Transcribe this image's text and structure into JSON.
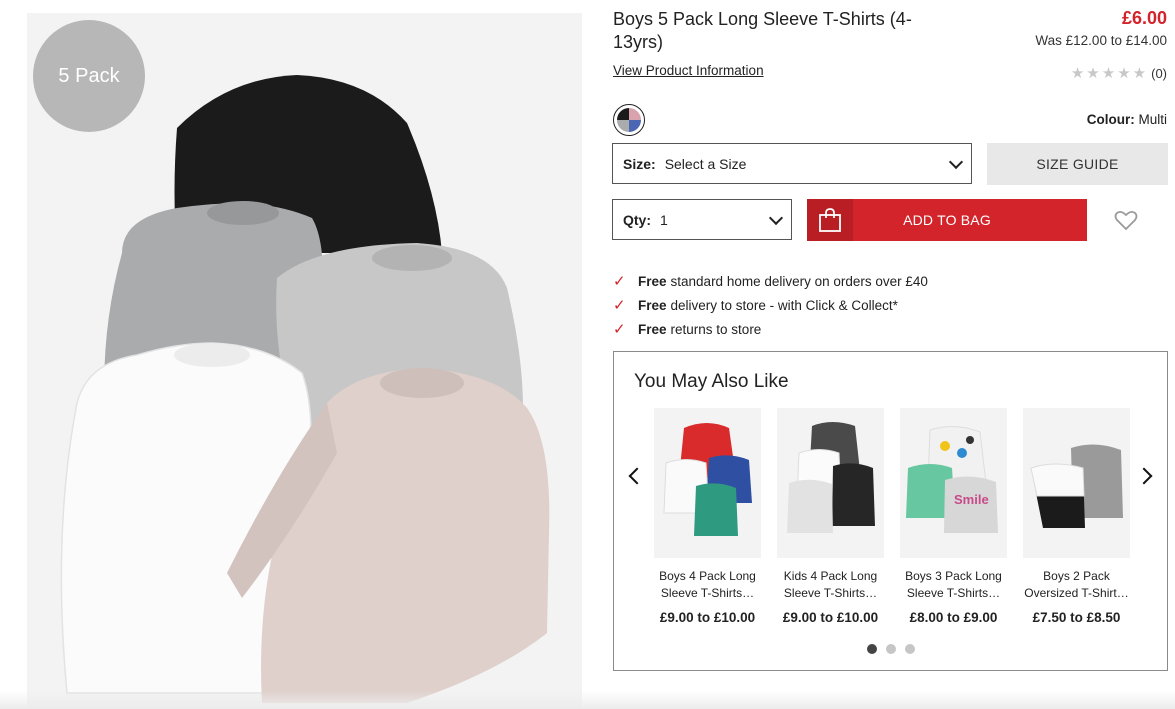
{
  "product": {
    "badge": "5 Pack",
    "title": "Boys 5 Pack Long Sleeve T-Shirts (4-13yrs)",
    "price": "£6.00",
    "was_price": "Was £12.00 to £14.00",
    "view_info": "View Product Information",
    "rating_count": "(0)",
    "rating_value": 0,
    "colour_label": "Colour:",
    "colour_value": "Multi",
    "size_label": "Size:",
    "size_value": "Select a Size",
    "size_guide": "SIZE GUIDE",
    "qty_label": "Qty:",
    "qty_value": "1",
    "add_to_bag": "ADD TO BAG",
    "accent_color": "#d4242b"
  },
  "benefits": [
    {
      "bold": "Free",
      "text": "standard home delivery on orders over £40"
    },
    {
      "bold": "Free",
      "text": "delivery to store - with Click & Collect*"
    },
    {
      "bold": "Free",
      "text": "returns to store"
    }
  ],
  "recommendations": {
    "title": "You May Also Like",
    "items": [
      {
        "name": "Boys 4 Pack Long Sleeve T-Shirts…",
        "price": "£9.00 to £10.00"
      },
      {
        "name": "Kids 4 Pack Long Sleeve T-Shirts…",
        "price": "£9.00 to £10.00"
      },
      {
        "name": "Boys 3 Pack Long Sleeve T-Shirts…",
        "price": "£8.00 to £9.00"
      },
      {
        "name": "Boys 2 Pack Oversized T-Shirt…",
        "price": "£7.50 to £8.50"
      }
    ],
    "active_page": 1,
    "page_count": 3
  }
}
